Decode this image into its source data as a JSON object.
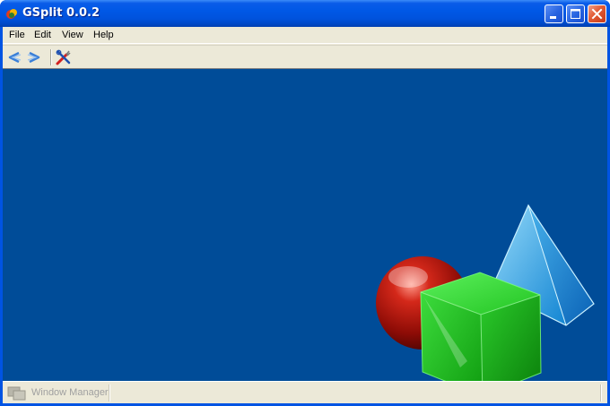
{
  "window": {
    "title": "GSplit 0.0.2",
    "app_icon": "gsplit-app-icon",
    "controls": [
      "minimize-icon",
      "maximize-icon",
      "close-icon"
    ]
  },
  "menubar": {
    "items": [
      {
        "label": "File"
      },
      {
        "label": "Edit"
      },
      {
        "label": "View"
      },
      {
        "label": "Help"
      }
    ]
  },
  "toolbar": {
    "buttons": [
      "back-arrow-icon",
      "forward-arrow-icon",
      "tools-icon"
    ]
  },
  "workspace": {
    "background": "#004c98",
    "decoration": [
      "red-sphere",
      "green-cube",
      "blue-pyramid"
    ]
  },
  "statusbar": {
    "window_manager_label": "Window Manager",
    "icon": "window-manager-icon"
  },
  "colors": {
    "titlebar": "#0054e3",
    "chrome": "#ece9d8",
    "close_button": "#e25a33"
  }
}
